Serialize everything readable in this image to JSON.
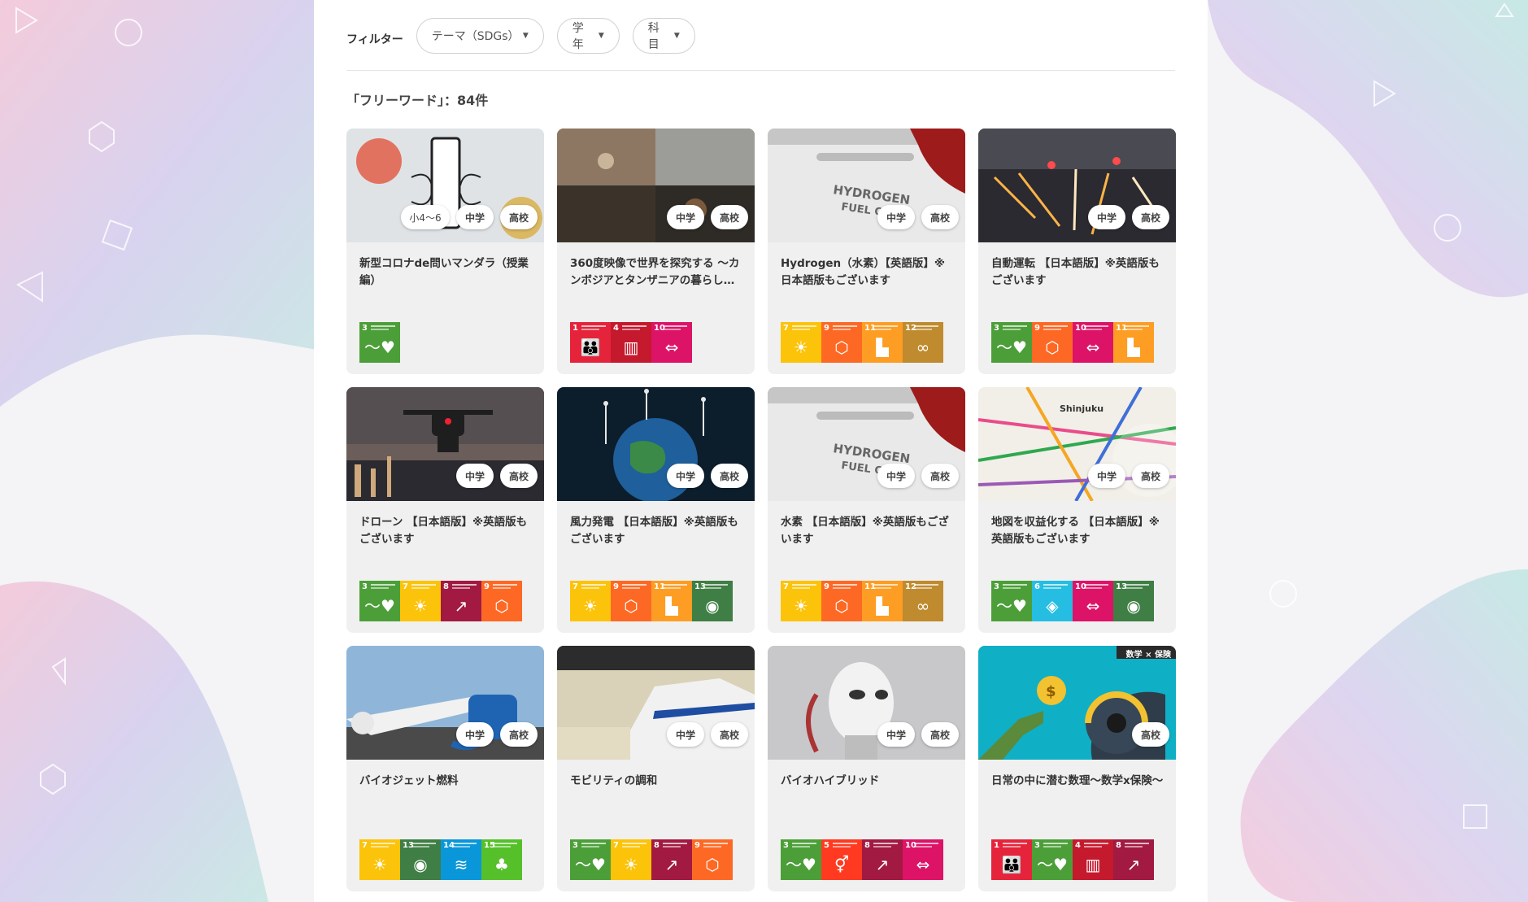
{
  "filter": {
    "label": "フィルター",
    "theme": "テーマ（SDGs）",
    "grade": "学年",
    "subject": "科目"
  },
  "result_count": "「フリーワード」：84件",
  "colors": {
    "sdg1": "#e5243b",
    "sdg3": "#4c9f38",
    "sdg4": "#c5192d",
    "sdg5": "#ff3a21",
    "sdg6": "#26bde2",
    "sdg7": "#fcc30b",
    "sdg8": "#a21942",
    "sdg9": "#fd6925",
    "sdg10": "#dd1367",
    "sdg11": "#fd9d24",
    "sdg12": "#bf8b2e",
    "sdg13": "#3f7e44",
    "sdg14": "#0a97d9",
    "sdg15": "#56c02b"
  },
  "cards": [
    {
      "title": "新型コロナde問いマンダラ（授業編）",
      "badges": [
        "小4〜6",
        "中学",
        "高校"
      ],
      "sdgs": [
        3
      ],
      "image": "mandala-illustration"
    },
    {
      "title": "360度映像で世界を探究する 〜カンボジアとタンザニアの暮らし…",
      "badges": [
        "中学",
        "高校"
      ],
      "sdgs": [
        1,
        4,
        10
      ],
      "image": "photo-collage"
    },
    {
      "title": "Hydrogen（水素）【英語版】※日本語版もございます",
      "badges": [
        "中学",
        "高校"
      ],
      "sdgs": [
        7,
        9,
        11,
        12
      ],
      "image": "hydrogen-car"
    },
    {
      "title": "自動運転 【日本語版】※英語版もございます",
      "badges": [
        "中学",
        "高校"
      ],
      "sdgs": [
        3,
        9,
        10,
        11
      ],
      "image": "night-traffic"
    },
    {
      "title": "ドローン 【日本語版】※英語版もございます",
      "badges": [
        "中学",
        "高校"
      ],
      "sdgs": [
        3,
        7,
        8,
        9
      ],
      "image": "drone-city"
    },
    {
      "title": "風力発電 【日本語版】※英語版もございます",
      "badges": [
        "中学",
        "高校"
      ],
      "sdgs": [
        7,
        9,
        11,
        13
      ],
      "image": "earth-windmills"
    },
    {
      "title": "水素 【日本語版】※英語版もございます",
      "badges": [
        "中学",
        "高校"
      ],
      "sdgs": [
        7,
        9,
        11,
        12
      ],
      "image": "hydrogen-car"
    },
    {
      "title": "地図を収益化する 【日本語版】※英語版もございます",
      "badges": [
        "中学",
        "高校"
      ],
      "sdgs": [
        3,
        6,
        10,
        13
      ],
      "image": "transit-map"
    },
    {
      "title": "バイオジェット燃料",
      "badges": [
        "中学",
        "高校"
      ],
      "sdgs": [
        7,
        13,
        14,
        15
      ],
      "image": "airplane-fuel"
    },
    {
      "title": "モビリティの調和",
      "badges": [
        "中学",
        "高校"
      ],
      "sdgs": [
        3,
        7,
        8,
        9
      ],
      "image": "bullet-train"
    },
    {
      "title": "バイオハイブリッド",
      "badges": [
        "中学",
        "高校"
      ],
      "sdgs": [
        3,
        5,
        8,
        10
      ],
      "image": "robot"
    },
    {
      "title": "日常の中に潜む数理〜数学x保険〜",
      "badges": [
        "高校"
      ],
      "sdgs": [
        1,
        3,
        4,
        8
      ],
      "image": "insurance-illustration",
      "image_label": "数学 × 保険"
    }
  ]
}
